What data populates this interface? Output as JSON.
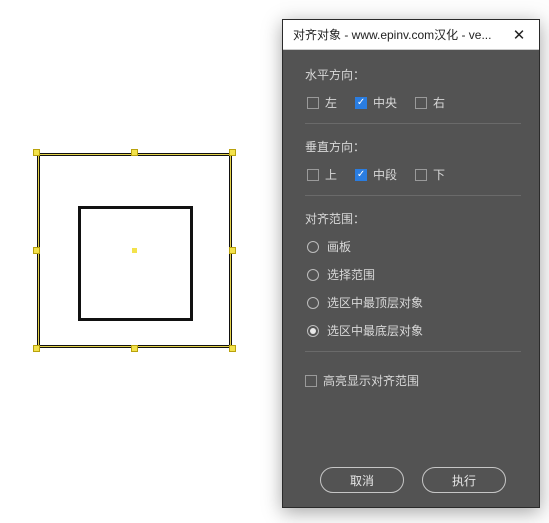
{
  "dialog": {
    "title": "对齐对象 - www.epinv.com汉化 - ve...",
    "horizontal": {
      "label": "水平方向：",
      "left": "左",
      "center": "中央",
      "right": "右",
      "left_checked": false,
      "center_checked": true,
      "right_checked": false
    },
    "vertical": {
      "label": "垂直方向：",
      "top": "上",
      "middle": "中段",
      "bottom": "下",
      "top_checked": false,
      "middle_checked": true,
      "bottom_checked": false
    },
    "scope": {
      "label": "对齐范围：",
      "options": [
        "画板",
        "选择范围",
        "选区中最顶层对象",
        "选区中最底层对象"
      ],
      "selected_index": 3
    },
    "highlight": {
      "label": "高亮显示对齐范围",
      "checked": false
    },
    "buttons": {
      "cancel": "取消",
      "execute": "执行"
    }
  }
}
